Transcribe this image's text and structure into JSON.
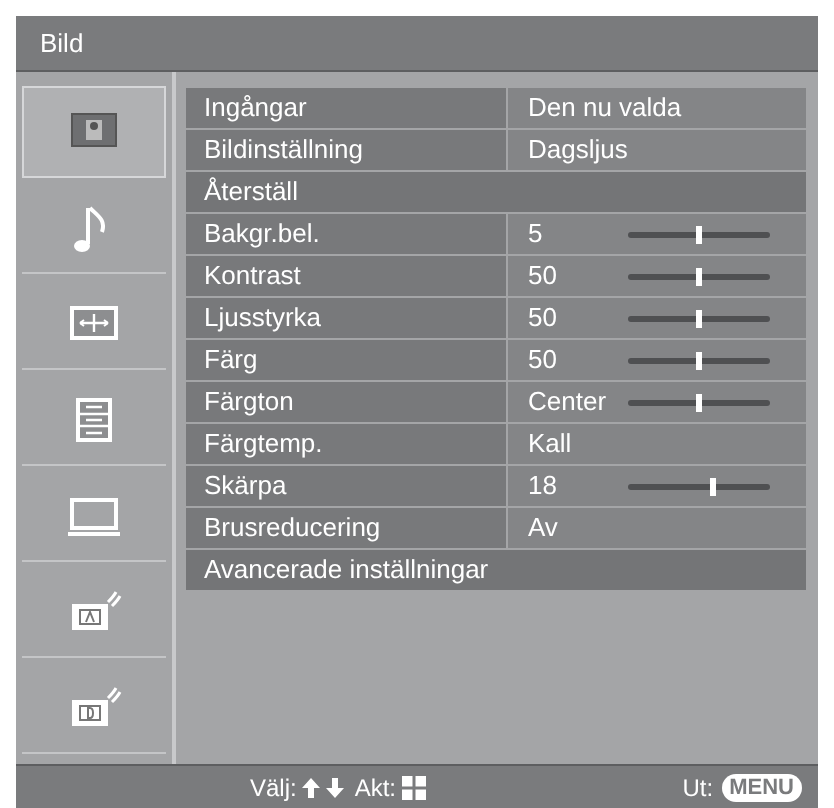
{
  "window": {
    "title": "Bild"
  },
  "sidebar": {
    "items": [
      {
        "selected": true
      },
      {
        "selected": false
      },
      {
        "selected": false
      },
      {
        "selected": false
      },
      {
        "selected": false
      },
      {
        "selected": false
      },
      {
        "selected": false
      }
    ]
  },
  "rows": [
    {
      "kind": "value",
      "label": "Ingångar",
      "value": "Den nu valda"
    },
    {
      "kind": "value",
      "label": "Bildinställning",
      "value": "Dagsljus"
    },
    {
      "kind": "action",
      "label": "Återställ"
    },
    {
      "kind": "slider",
      "label": "Bakgr.bel.",
      "value": "5",
      "level": 0.5
    },
    {
      "kind": "slider",
      "label": "Kontrast",
      "value": "50",
      "level": 0.5
    },
    {
      "kind": "slider",
      "label": "Ljusstyrka",
      "value": "50",
      "level": 0.5
    },
    {
      "kind": "slider",
      "label": "Färg",
      "value": "50",
      "level": 0.5
    },
    {
      "kind": "slider",
      "label": "Färgton",
      "value": "Center",
      "level": 0.5
    },
    {
      "kind": "value",
      "label": "Färgtemp.",
      "value": "Kall"
    },
    {
      "kind": "slider",
      "label": "Skärpa",
      "value": "18",
      "level": 0.6
    },
    {
      "kind": "value",
      "label": "Brusreducering",
      "value": "Av"
    },
    {
      "kind": "action",
      "label": "Avancerade inställningar"
    }
  ],
  "footer": {
    "select_label": "Välj:",
    "enter_label": "Akt:",
    "exit_label": "Ut:",
    "menu_key": "MENU"
  }
}
